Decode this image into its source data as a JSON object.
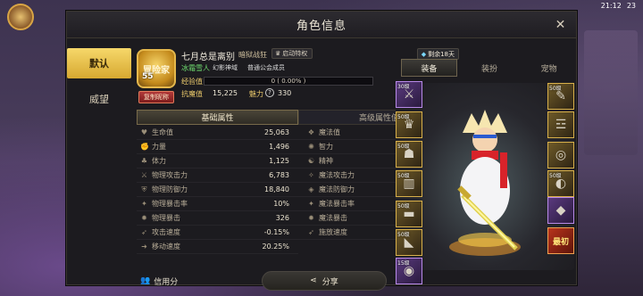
{
  "window": {
    "title": "角色信息"
  },
  "status_bar": {
    "time": "21:12",
    "battery": "23"
  },
  "left_tabs": [
    {
      "label": "默认",
      "active": true
    },
    {
      "label": "威望",
      "active": false
    }
  ],
  "profile": {
    "emblem_label": "冒险家",
    "level": "55",
    "copy_button": "复制昵称",
    "name": "七月总是离别",
    "class": "暗狱战狂",
    "privilege": "启动特权",
    "remain": "剩余18天",
    "title_tag": "冰霜雪人",
    "guild": "幻影神域",
    "member": "普通公会成员",
    "exp_label": "经验值",
    "exp_text": "0 ( 0.00% )",
    "exp_percent": 0,
    "resist_label": "抗魔值",
    "resist_value": "15,225",
    "charm_label": "魅力",
    "charm_icon": "?",
    "charm_value": "330"
  },
  "attr_tabs": [
    {
      "label": "基础属性",
      "active": true
    },
    {
      "label": "高级属性值",
      "active": false
    }
  ],
  "attributes_left": [
    {
      "icon": "heart-icon",
      "glyph": "♥",
      "name": "生命值",
      "value": "25,063"
    },
    {
      "icon": "fist-icon",
      "glyph": "✊",
      "name": "力量",
      "value": "1,496"
    },
    {
      "icon": "stamina-icon",
      "glyph": "♣",
      "name": "体力",
      "value": "1,125"
    },
    {
      "icon": "sword-icon",
      "glyph": "⚔",
      "name": "物理攻击力",
      "value": "6,783"
    },
    {
      "icon": "shield-icon",
      "glyph": "⛨",
      "name": "物理防御力",
      "value": "18,840"
    },
    {
      "icon": "crit-rate-icon",
      "glyph": "✦",
      "name": "物理暴击率",
      "value": "10%"
    },
    {
      "icon": "crit-icon",
      "glyph": "✹",
      "name": "物理暴击",
      "value": "326"
    },
    {
      "icon": "attack-speed-icon",
      "glyph": "➶",
      "name": "攻击速度",
      "value": "-0.15%"
    },
    {
      "icon": "move-speed-icon",
      "glyph": "➜",
      "name": "移动速度",
      "value": "20.25%"
    }
  ],
  "attributes_right": [
    {
      "icon": "mana-icon",
      "glyph": "❖",
      "name": "魔法值",
      "value": "21,795"
    },
    {
      "icon": "intelligence-icon",
      "glyph": "✺",
      "name": "智力",
      "value": "996"
    },
    {
      "icon": "spirit-icon",
      "glyph": "☯",
      "name": "精神",
      "value": "1,030"
    },
    {
      "icon": "magic-attack-icon",
      "glyph": "✧",
      "name": "魔法攻击力",
      "value": "3,663"
    },
    {
      "icon": "magic-defense-icon",
      "glyph": "◈",
      "name": "魔法防御力",
      "value": "16,545"
    },
    {
      "icon": "magic-crit-rate-icon",
      "glyph": "✦",
      "name": "魔法暴击率",
      "value": "0%"
    },
    {
      "icon": "magic-crit-icon",
      "glyph": "✹",
      "name": "魔法暴击",
      "value": "306"
    },
    {
      "icon": "cast-speed-icon",
      "glyph": "➶",
      "name": "施放速度",
      "value": "11.65%"
    }
  ],
  "bottom": {
    "credit_label": "信用分",
    "share_label": "分享"
  },
  "right_tabs": [
    {
      "label": "装备",
      "active": true
    },
    {
      "label": "装扮",
      "active": false
    },
    {
      "label": "宠物",
      "active": false
    }
  ],
  "equip_left": [
    {
      "lv": "30级",
      "icon": "weapon-slot-icon",
      "glyph": "⚔",
      "style": "purple"
    },
    {
      "lv": "50级",
      "icon": "top-slot-icon",
      "glyph": "♛",
      "style": "gold"
    },
    {
      "lv": "50级",
      "icon": "head-slot-icon",
      "glyph": "☗",
      "style": "gold"
    },
    {
      "lv": "50级",
      "icon": "pants-slot-icon",
      "glyph": "▥",
      "style": "gold"
    },
    {
      "lv": "50级",
      "icon": "belt-slot-icon",
      "glyph": "▬",
      "style": "gold"
    },
    {
      "lv": "50级",
      "icon": "shoes-slot-icon",
      "glyph": "◣",
      "style": "gold"
    },
    {
      "lv": "15级",
      "icon": "title-slot-icon",
      "glyph": "◉",
      "style": "purple"
    }
  ],
  "equip_right": [
    {
      "lv": "50级",
      "icon": "necklace-slot-icon",
      "glyph": "✎",
      "style": "gold"
    },
    {
      "lv": "",
      "icon": "bracelet-slot-icon",
      "glyph": "☲",
      "style": "gold"
    },
    {
      "lv": "",
      "icon": "ring-slot-icon",
      "glyph": "◎",
      "style": "gold"
    },
    {
      "lv": "50级",
      "icon": "accessory-slot-icon",
      "glyph": "◐",
      "style": "gold"
    },
    {
      "lv": "",
      "icon": "magic-stone-slot-icon",
      "glyph": "◆",
      "style": "purple"
    },
    {
      "lv": "",
      "icon": "strongest-slot-icon",
      "glyph": "最初",
      "style": "red"
    }
  ]
}
